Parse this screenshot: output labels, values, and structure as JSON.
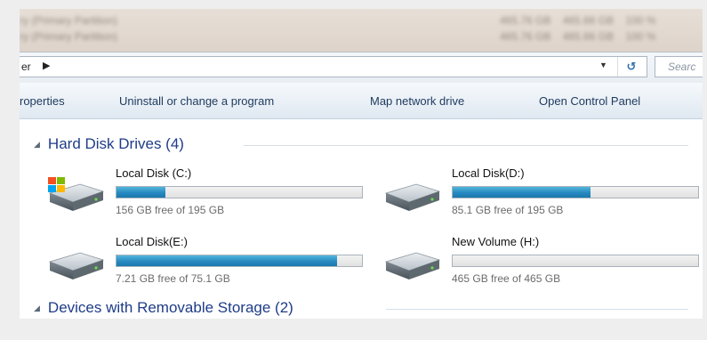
{
  "window": {
    "background": "#eeeeee",
    "accent": "#1e3c88"
  },
  "address_bar": {
    "path_text": "er",
    "arrow": "▶",
    "dropdown_icon": "chevron-down-icon",
    "refresh_label": "↺",
    "search_placeholder": "Searc"
  },
  "command_bar": {
    "items": [
      {
        "label": "roperties"
      },
      {
        "label": "Uninstall or change a program"
      },
      {
        "label": "Map network drive"
      },
      {
        "label": "Open Control Panel"
      }
    ]
  },
  "groups": {
    "hard_disks": {
      "title": "Hard Disk Drives (4)",
      "drives": [
        {
          "name": "Local Disk (C:)",
          "free_text": "156 GB free of 195 GB",
          "used_fraction": 0.2,
          "icon": "windows-drive-icon"
        },
        {
          "name": "Local Disk(D:)",
          "free_text": "85.1 GB free of 195 GB",
          "used_fraction": 0.56,
          "icon": "hard-drive-icon"
        },
        {
          "name": "Local Disk(E:)",
          "free_text": "7.21 GB free of 75.1 GB",
          "used_fraction": 0.9,
          "icon": "hard-drive-icon"
        },
        {
          "name": "New Volume (H:)",
          "free_text": "465 GB free of 465 GB",
          "used_fraction": 0.0,
          "icon": "hard-drive-icon"
        }
      ]
    },
    "removable": {
      "title": "Devices with Removable Storage (2)"
    }
  },
  "colors": {
    "bar_fill": "#2689c0",
    "header_text": "#1e3c88"
  }
}
